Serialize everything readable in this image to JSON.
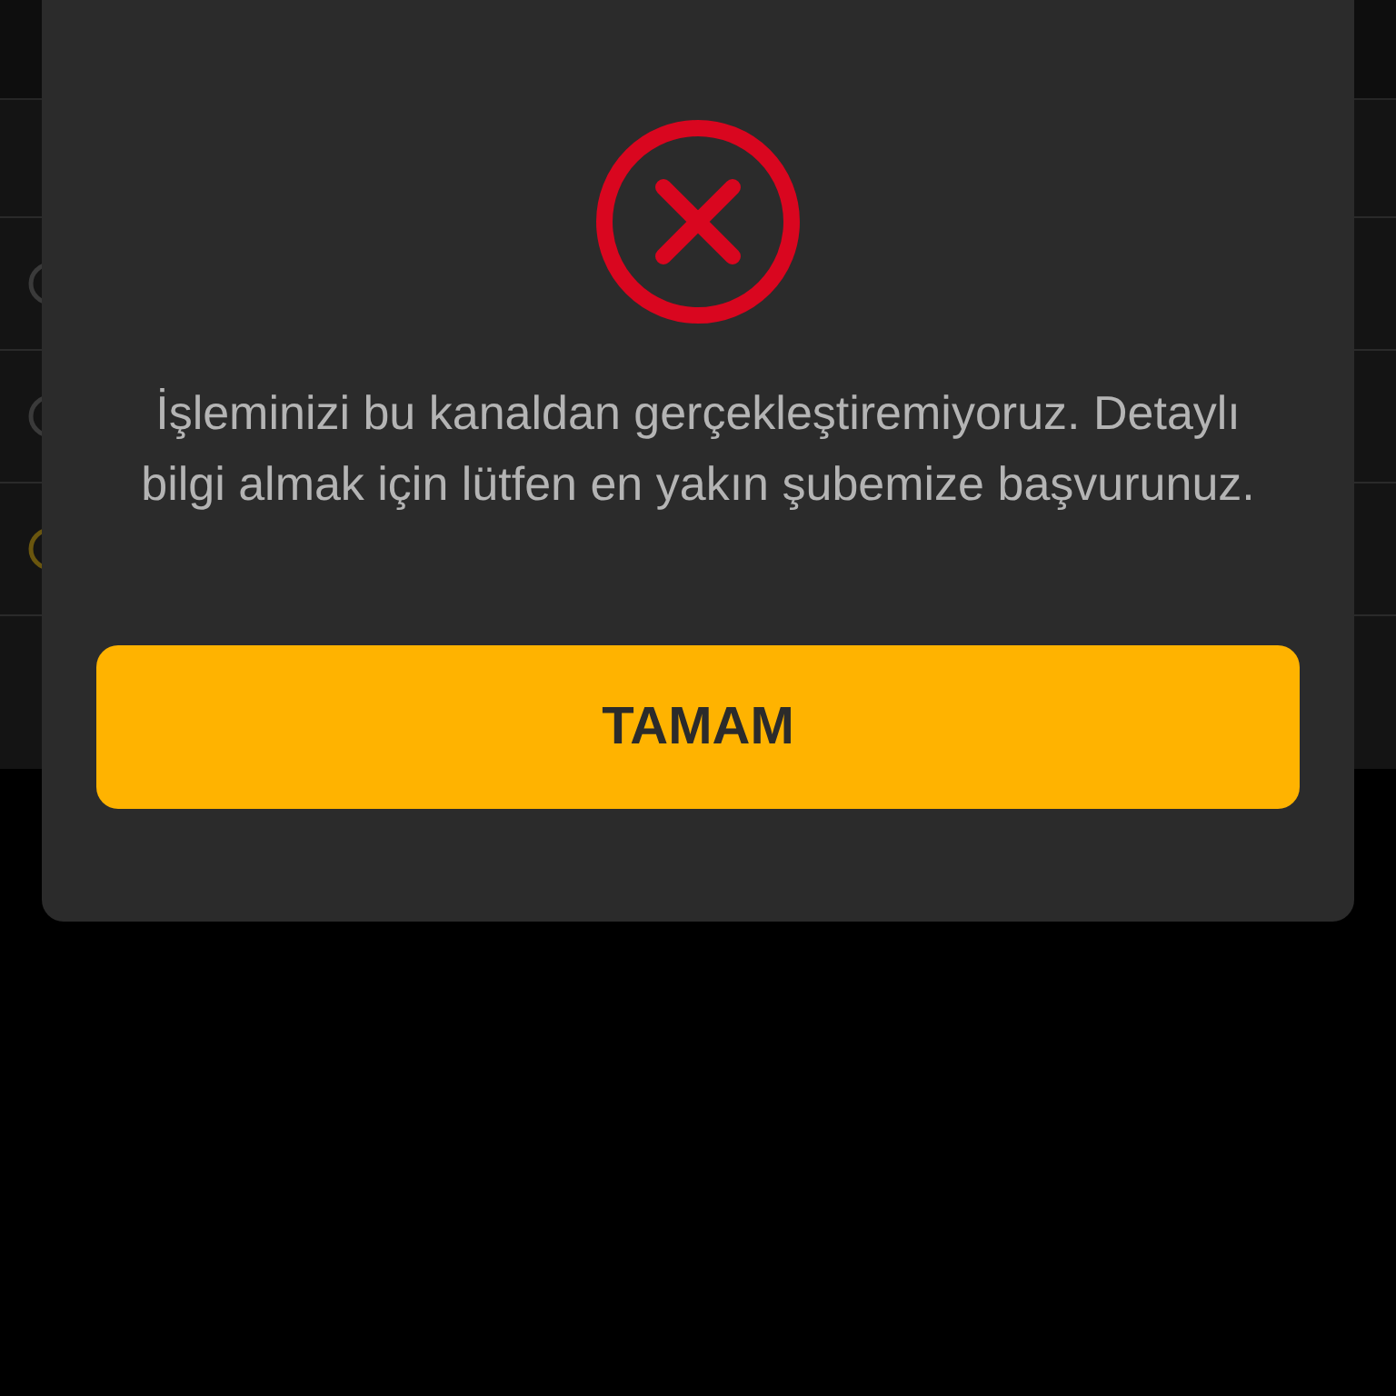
{
  "background_list": {
    "rows": [
      {
        "kind": "header"
      },
      {
        "kind": "option",
        "selected": false
      },
      {
        "kind": "option",
        "selected": false
      },
      {
        "kind": "option",
        "selected": true
      }
    ]
  },
  "dialog": {
    "kind": "error",
    "message": "İşleminizi bu kanaldan gerçekleştiremiyoruz. Detaylı bilgi almak için lütfen en yakın şubemize başvurunuz.",
    "button": "TAMAM"
  }
}
